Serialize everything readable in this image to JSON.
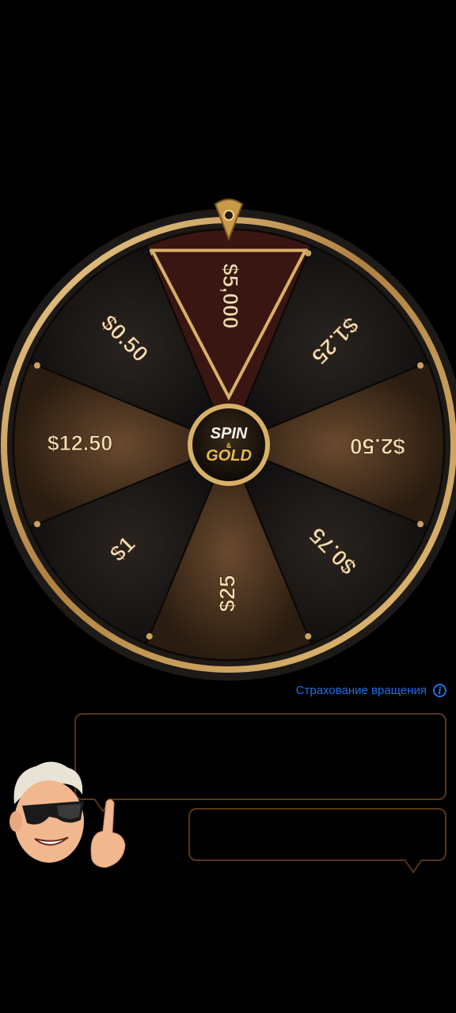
{
  "wheel": {
    "center_logo": {
      "line1": "SPIN",
      "amp": "&",
      "line2": "GOLD"
    },
    "segments": [
      {
        "label": "$5,000",
        "highlighted": true
      },
      {
        "label": "$1.25",
        "highlighted": false
      },
      {
        "label": "$2.50",
        "highlighted": false
      },
      {
        "label": "$0.75",
        "highlighted": false
      },
      {
        "label": "$25",
        "highlighted": false
      },
      {
        "label": "$1",
        "highlighted": false
      },
      {
        "label": "$12.50",
        "highlighted": false
      },
      {
        "label": "$0.50",
        "highlighted": false
      }
    ],
    "colors": {
      "gold": "#d8b167",
      "dark_segment": "#1d1611",
      "light_segment": "#3a2818",
      "highlight_segment": "#3a1612"
    }
  },
  "insurance": {
    "label": "Страхование вращения",
    "icon": "info-icon"
  },
  "dialog": {
    "bubble_1_text": "",
    "bubble_2_text": ""
  },
  "mascot": {
    "icon": "mascot-avatar-with-sunglasses"
  }
}
